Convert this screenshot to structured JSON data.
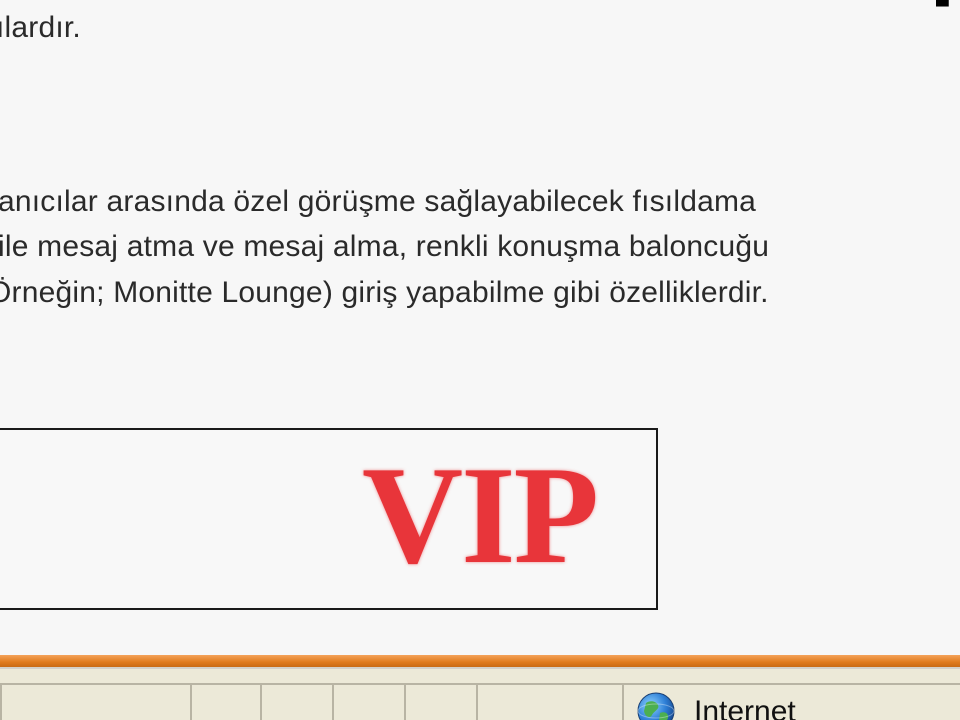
{
  "content": {
    "line_top": "ılardır.",
    "paragraph_lines": [
      "anıcılar arasında özel görüşme sağlayabilecek fısıldama",
      " ile mesaj atma ve mesaj alma, renkli konuşma baloncuğu",
      "Örneğin; Monitte Lounge) giriş yapabilme gibi özelliklerdir."
    ],
    "vip_label": "VIP",
    "vip_color": "#e8353a"
  },
  "statusbar": {
    "zone_label": "Internet",
    "zone_icon": "globe-icon",
    "accent_bar_color": "#e07a1c"
  }
}
